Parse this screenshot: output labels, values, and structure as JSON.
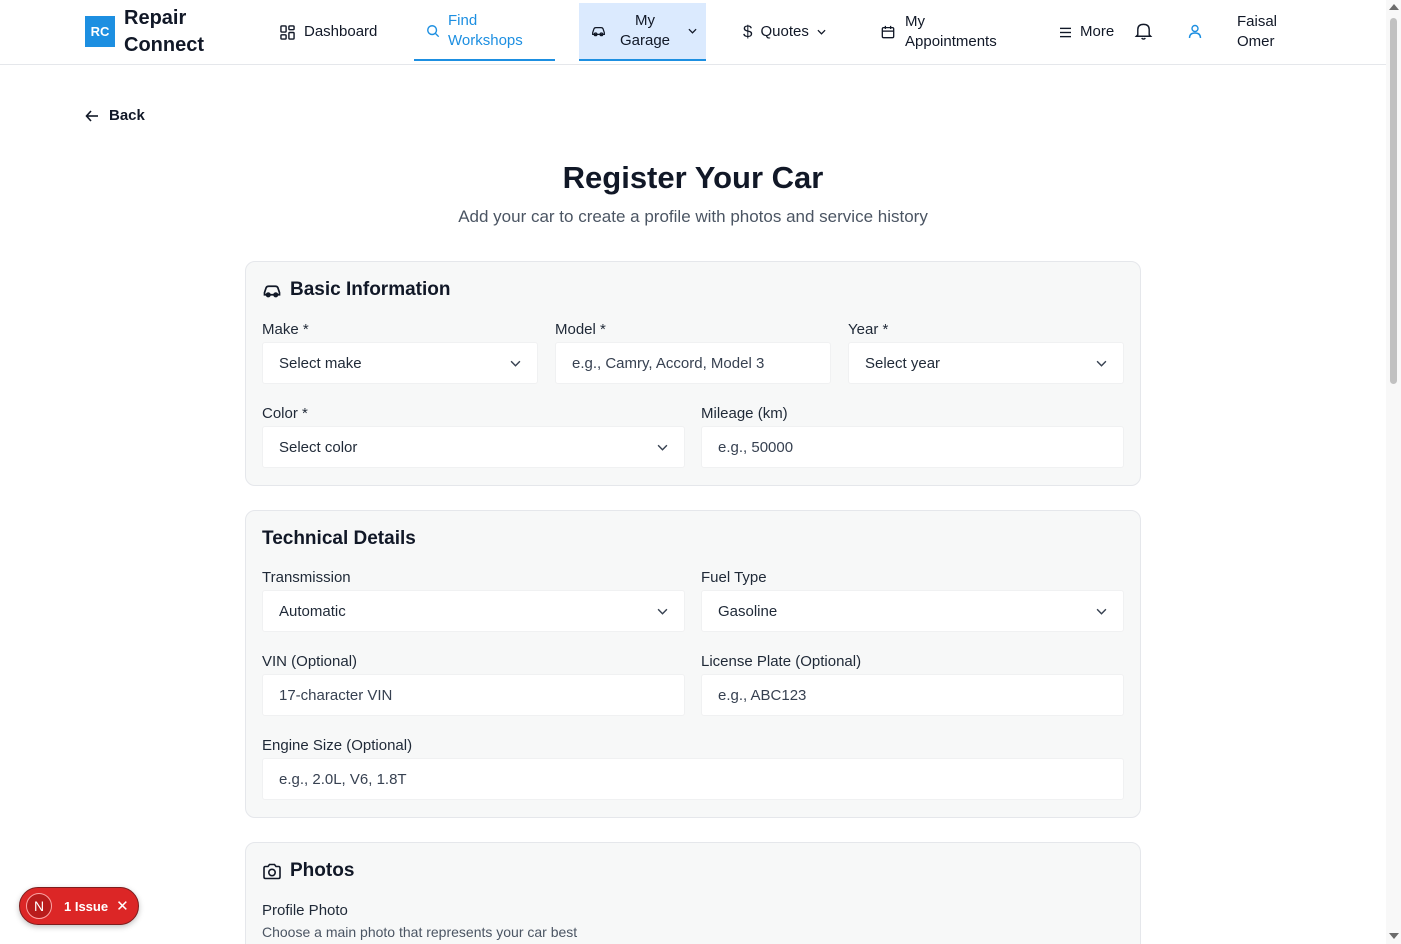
{
  "header": {
    "logo_short": "RC",
    "logo_text": "Repair Connect",
    "nav": {
      "dashboard": "Dashboard",
      "find_workshops": "Find Workshops",
      "my_garage": "My Garage",
      "quotes": "Quotes",
      "my_appointments": "My Appointments",
      "more": "More"
    },
    "user_name": "Faisal Omer"
  },
  "back_label": "Back",
  "page": {
    "title": "Register Your Car",
    "subtitle": "Add your car to create a profile with photos and service history"
  },
  "basic": {
    "title": "Basic Information",
    "make_label": "Make *",
    "make_value": "Select make",
    "model_label": "Model *",
    "model_placeholder": "e.g., Camry, Accord, Model 3",
    "year_label": "Year *",
    "year_value": "Select year",
    "color_label": "Color *",
    "color_value": "Select color",
    "mileage_label": "Mileage (km)",
    "mileage_placeholder": "e.g., 50000"
  },
  "technical": {
    "title": "Technical Details",
    "transmission_label": "Transmission",
    "transmission_value": "Automatic",
    "fuel_label": "Fuel Type",
    "fuel_value": "Gasoline",
    "vin_label": "VIN (Optional)",
    "vin_placeholder": "17-character VIN",
    "plate_label": "License Plate (Optional)",
    "plate_placeholder": "e.g., ABC123",
    "engine_label": "Engine Size (Optional)",
    "engine_placeholder": "e.g., 2.0L, V6, 1.8T"
  },
  "photos": {
    "title": "Photos",
    "profile_label": "Profile Photo",
    "profile_help": "Choose a main photo that represents your car best"
  },
  "issue_badge": {
    "letter": "N",
    "label": "1 Issue"
  },
  "colors": {
    "accent": "#1d8fe1",
    "issue": "#dc2626"
  }
}
